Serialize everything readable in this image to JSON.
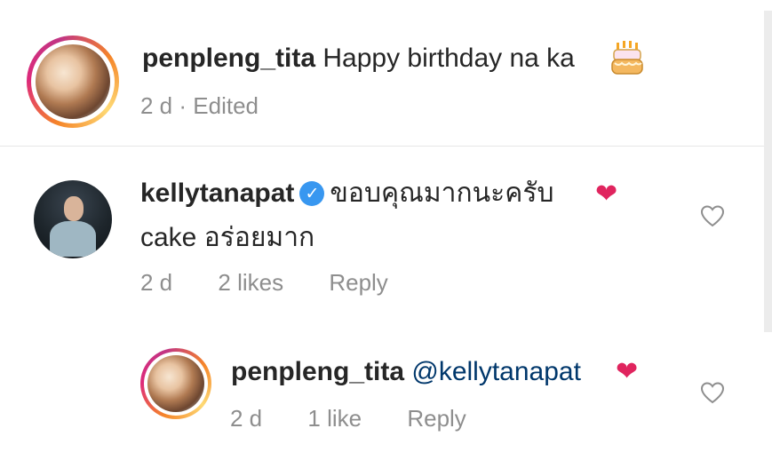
{
  "comments": [
    {
      "username": "penpleng_tita",
      "text": "Happy birthday na ka",
      "emoji": "birthday-cake",
      "time": "2 d",
      "separator": "·",
      "edited": "Edited"
    },
    {
      "username": "kellytanapat",
      "verified": true,
      "text_line1": "ขอบคุณมากนะครับ",
      "heart": "❤",
      "text_line2": "cake อร่อยมาก",
      "time": "2 d",
      "likes": "2 likes",
      "reply": "Reply",
      "like_icon": "heart-outline-icon"
    }
  ],
  "reply": {
    "username": "penpleng_tita",
    "mention": "@kellytanapat",
    "heart": "❤",
    "time": "2 d",
    "likes": "1 like",
    "reply": "Reply",
    "like_icon": "heart-outline-icon"
  },
  "colors": {
    "username": "#262626",
    "meta": "#8e8e8e",
    "mention": "#00376b",
    "heart": "#e0245e",
    "verified": "#3897f0"
  }
}
